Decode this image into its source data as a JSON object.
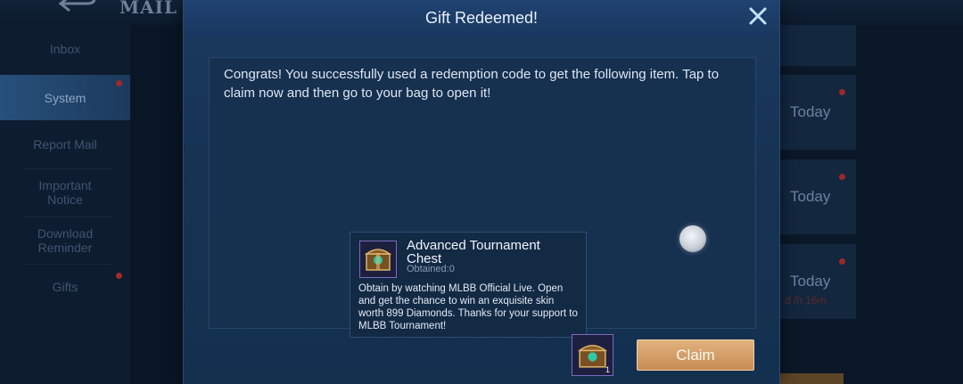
{
  "background": {
    "title": "MAIL",
    "sidebar": {
      "items": [
        {
          "label": "Inbox"
        },
        {
          "label": "System"
        },
        {
          "label": "Report Mail"
        },
        {
          "label": "Important Notice"
        },
        {
          "label": "Download Reminder"
        },
        {
          "label": "Gifts"
        }
      ]
    },
    "mail_list": {
      "items": [
        {
          "date": "Today",
          "sub": ""
        },
        {
          "date": "Today",
          "sub": ""
        },
        {
          "date": "Today",
          "sub": ""
        },
        {
          "date": "Today",
          "sub": "d /h 16m"
        }
      ]
    }
  },
  "dialog": {
    "title": "Gift Redeemed!",
    "message": "Congrats! You successfully used a redemption code to get the following item. Tap to claim now and then go to your bag to open it!",
    "item": {
      "name": "Advanced Tournament Chest",
      "obtained": "Obtained:0",
      "description": "Obtain by watching MLBB Official Live. Open and get the chance to win an exquisite skin worth 899 Diamonds. Thanks for your support to MLBB Tournament!"
    },
    "reward": {
      "count": "1"
    },
    "claim_label": "Claim"
  },
  "colors": {
    "accent": "#d4a06a",
    "dialog_bg": "#163354",
    "notification_dot": "#a02a2a"
  }
}
